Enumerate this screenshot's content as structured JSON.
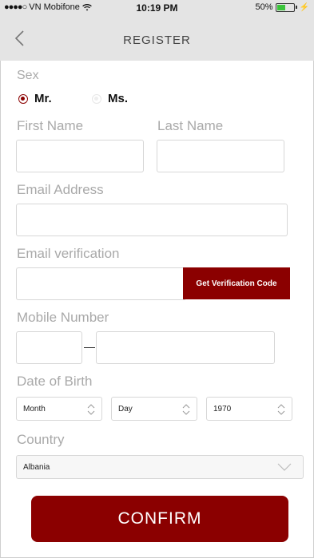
{
  "status_bar": {
    "signal_dots": "●●●●○",
    "carrier": "VN Mobifone",
    "time": "10:19 PM",
    "battery": "50%",
    "battery_level": 0.5
  },
  "nav": {
    "title": "REGISTER",
    "back_icon": "chevron-left-icon"
  },
  "form": {
    "sex_label": "Sex",
    "sex_options": [
      {
        "label": "Mr.",
        "selected": true
      },
      {
        "label": "Ms.",
        "selected": false
      }
    ],
    "first_name_label": "First Name",
    "first_name_value": "",
    "last_name_label": "Last Name",
    "last_name_value": "",
    "email_label": "Email Address",
    "email_value": "",
    "email_verification_label": "Email verification",
    "email_verification_value": "",
    "get_code_button": "Get Verification Code",
    "mobile_label": "Mobile Number",
    "mobile_dash": "–",
    "dob_label": "Date of Birth",
    "dob_month": "Month",
    "dob_day": "Day",
    "dob_year": "1970",
    "country_label": "Country",
    "country_value": "Albania"
  },
  "confirm_button": "CONFIRM",
  "colors": {
    "accent": "#8b0000",
    "bar_bg": "#e4e4e4",
    "label": "#a9a9a9"
  }
}
